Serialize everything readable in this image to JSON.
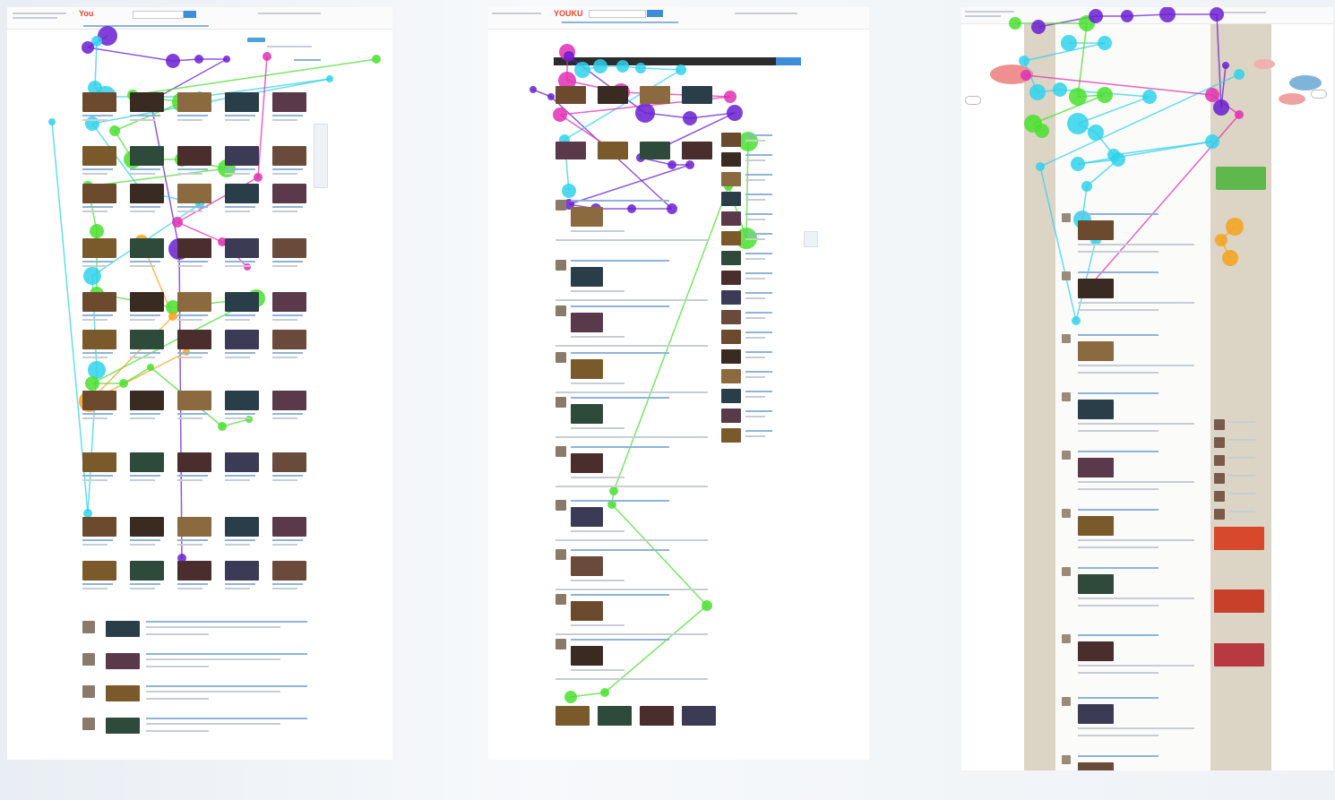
{
  "figure": {
    "description_panels": 3
  },
  "panels": [
    {
      "id": "homepage",
      "logo": "You",
      "header_left": "",
      "colors": {
        "fixation_purple": "#6a1fd1",
        "fixation_cyan": "#2fd2ec",
        "fixation_green": "#49e02f",
        "fixation_magenta": "#e02fb4",
        "fixation_orange": "#f5a21b"
      }
    },
    {
      "id": "video-page",
      "logo": "YOUKU"
    },
    {
      "id": "feed-page",
      "logo": ""
    }
  ],
  "footer_text": ""
}
